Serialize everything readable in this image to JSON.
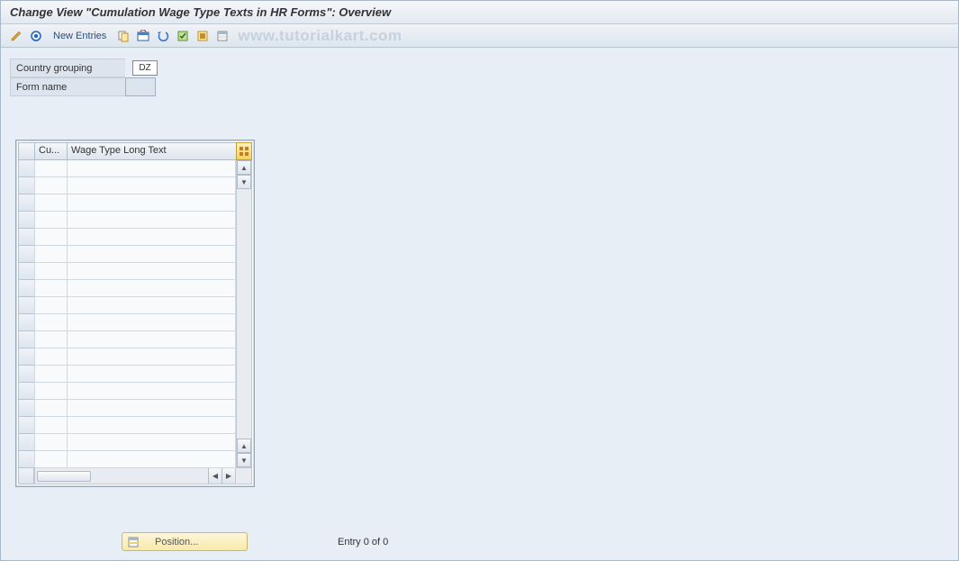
{
  "title": "Change View \"Cumulation Wage Type Texts in HR Forms\": Overview",
  "toolbar": {
    "new_entries": "New Entries"
  },
  "watermark": "www.tutorialkart.com",
  "fields": {
    "country_grouping_label": "Country grouping",
    "country_grouping_value": "DZ",
    "form_name_label": "Form name",
    "form_name_value": ""
  },
  "table": {
    "col1_header": "Cu...",
    "col2_header": "Wage Type Long Text",
    "row_count": 18
  },
  "footer": {
    "position_label": "Position...",
    "entry_text": "Entry 0 of 0"
  }
}
